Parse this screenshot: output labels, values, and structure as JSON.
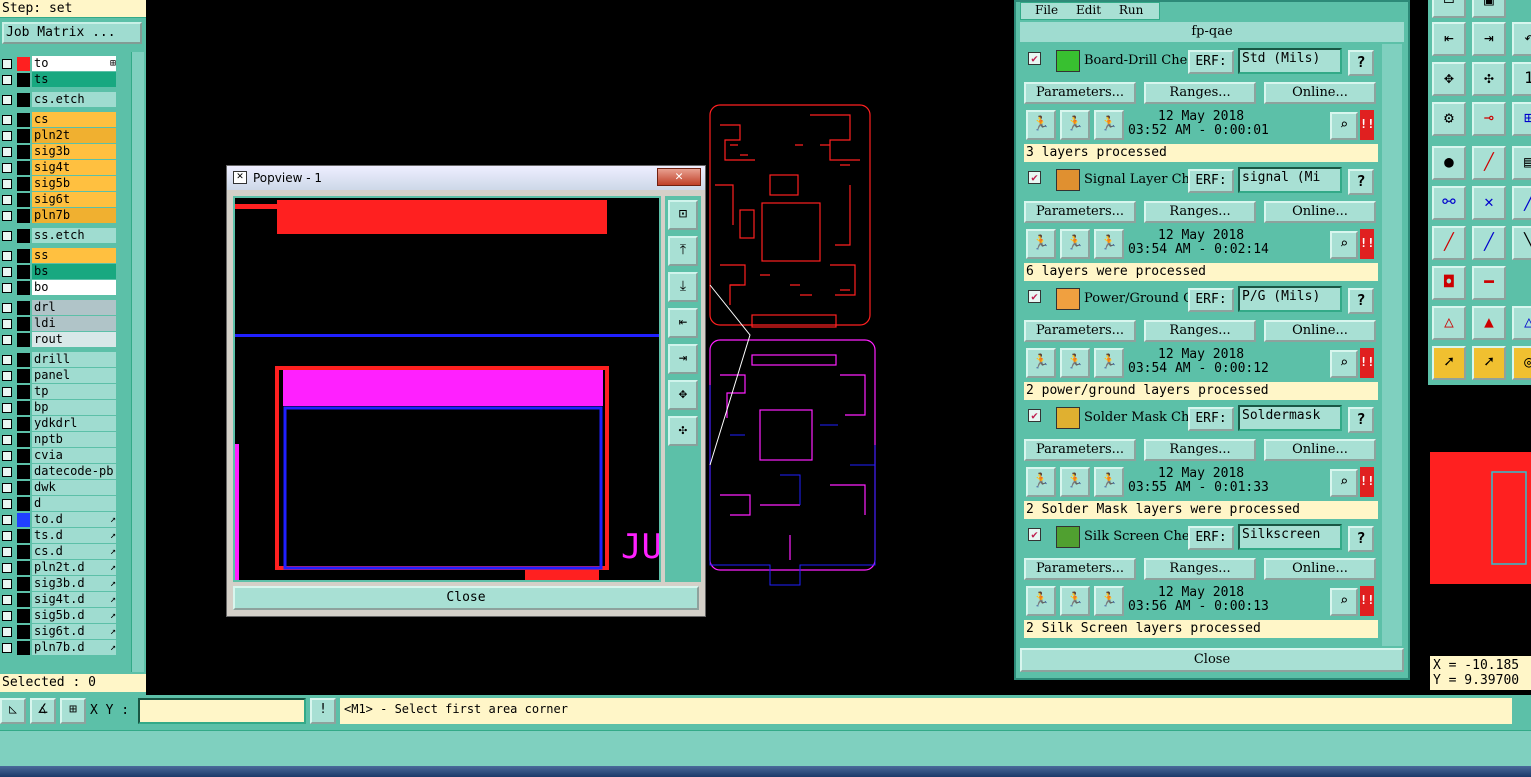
{
  "step_label": "Step: set",
  "job_matrix_label": "Job Matrix ...",
  "layers": [
    {
      "name": "to",
      "color": "#ffffff",
      "sel": "#ff2020",
      "arrow": "⊞",
      "check": "■"
    },
    {
      "name": "ts",
      "color": "#18a880",
      "sel": "#000000",
      "arrow": "",
      "check": ""
    },
    {
      "name": "cs.etch",
      "color": "#9fdcd0",
      "sel": "#000000",
      "arrow": "",
      "check": ""
    },
    {
      "name": "cs",
      "color": "#ffc040",
      "sel": "#000000",
      "arrow": "",
      "check": ""
    },
    {
      "name": "pln2t",
      "color": "#f0b030",
      "sel": "#000000",
      "arrow": "",
      "check": ""
    },
    {
      "name": "sig3b",
      "color": "#ffc040",
      "sel": "#000000",
      "arrow": "",
      "check": ""
    },
    {
      "name": "sig4t",
      "color": "#ffc040",
      "sel": "#000000",
      "arrow": "",
      "check": ""
    },
    {
      "name": "sig5b",
      "color": "#ffc040",
      "sel": "#000000",
      "arrow": "",
      "check": ""
    },
    {
      "name": "sig6t",
      "color": "#ffc040",
      "sel": "#000000",
      "arrow": "",
      "check": ""
    },
    {
      "name": "pln7b",
      "color": "#f0b030",
      "sel": "#000000",
      "arrow": "",
      "check": ""
    },
    {
      "name": "ss.etch",
      "color": "#9fdcd0",
      "sel": "#000000",
      "arrow": "",
      "check": ""
    },
    {
      "name": "ss",
      "color": "#ffc040",
      "sel": "#000000",
      "arrow": "",
      "check": ""
    },
    {
      "name": "bs",
      "color": "#18a880",
      "sel": "#000000",
      "arrow": "",
      "check": ""
    },
    {
      "name": "bo",
      "color": "#ffffff",
      "sel": "#000000",
      "arrow": "",
      "check": ""
    },
    {
      "name": "drl",
      "color": "#b0c4c8",
      "sel": "#000000",
      "arrow": "",
      "check": ""
    },
    {
      "name": "ldi",
      "color": "#b0c4c8",
      "sel": "#000000",
      "arrow": "",
      "check": ""
    },
    {
      "name": "rout",
      "color": "#d8e8e8",
      "sel": "#000000",
      "arrow": "",
      "check": ""
    },
    {
      "name": "drill",
      "color": "#9fdcd0",
      "sel": "#000000",
      "arrow": "",
      "check": ""
    },
    {
      "name": "panel",
      "color": "#9fdcd0",
      "sel": "#000000",
      "arrow": "",
      "check": ""
    },
    {
      "name": "tp",
      "color": "#9fdcd0",
      "sel": "#000000",
      "arrow": "",
      "check": ""
    },
    {
      "name": "bp",
      "color": "#9fdcd0",
      "sel": "#000000",
      "arrow": "",
      "check": ""
    },
    {
      "name": "ydkdrl",
      "color": "#9fdcd0",
      "sel": "#000000",
      "arrow": "",
      "check": ""
    },
    {
      "name": "nptb",
      "color": "#9fdcd0",
      "sel": "#000000",
      "arrow": "",
      "check": ""
    },
    {
      "name": "cvia",
      "color": "#9fdcd0",
      "sel": "#000000",
      "arrow": "",
      "check": ""
    },
    {
      "name": "datecode-pb",
      "color": "#9fdcd0",
      "sel": "#000000",
      "arrow": "",
      "check": ""
    },
    {
      "name": "dwk",
      "color": "#9fdcd0",
      "sel": "#000000",
      "arrow": "",
      "check": ""
    },
    {
      "name": "d",
      "color": "#9fdcd0",
      "sel": "#000000",
      "arrow": "",
      "check": ""
    },
    {
      "name": "to.d",
      "color": "#9fdcd0",
      "sel": "#2040ff",
      "arrow": "↗",
      "check": ""
    },
    {
      "name": "ts.d",
      "color": "#9fdcd0",
      "sel": "#000000",
      "arrow": "↗",
      "check": ""
    },
    {
      "name": "cs.d",
      "color": "#9fdcd0",
      "sel": "#000000",
      "arrow": "↗",
      "check": ""
    },
    {
      "name": "pln2t.d",
      "color": "#9fdcd0",
      "sel": "#000000",
      "arrow": "↗",
      "check": ""
    },
    {
      "name": "sig3b.d",
      "color": "#9fdcd0",
      "sel": "#000000",
      "arrow": "↗",
      "check": ""
    },
    {
      "name": "sig4t.d",
      "color": "#9fdcd0",
      "sel": "#000000",
      "arrow": "↗",
      "check": ""
    },
    {
      "name": "sig5b.d",
      "color": "#9fdcd0",
      "sel": "#000000",
      "arrow": "↗",
      "check": ""
    },
    {
      "name": "sig6t.d",
      "color": "#9fdcd0",
      "sel": "#000000",
      "arrow": "↗",
      "check": ""
    },
    {
      "name": "pln7b.d",
      "color": "#9fdcd0",
      "sel": "#000000",
      "arrow": "↗",
      "check": ""
    }
  ],
  "selected_label": "Selected : 0",
  "popview": {
    "title": "Popview - 1",
    "close_x": "✕",
    "close_label": "Close",
    "overlay_text": "JU"
  },
  "checklist": {
    "menu": [
      "File",
      "Edit",
      "Run"
    ],
    "title": "fp-qae",
    "param_label": "Parameters...",
    "ranges_label": "Ranges...",
    "online_label": "Online...",
    "erf_label": "ERF:",
    "q_label": "?",
    "bang_label": "!!",
    "check_mark": "✔",
    "close_label": "Close",
    "items": [
      {
        "name": "Board-Drill Che",
        "erf": "Std (Mils)",
        "date": "12 May 2018",
        "time": "03:52 AM - 0:00:01",
        "status": "3 layers processed",
        "icon_color": "#38c030"
      },
      {
        "name": "Signal Layer Ch",
        "erf": "signal (Mi",
        "date": "12 May 2018",
        "time": "03:54 AM - 0:02:14",
        "status": "6 layers were processed",
        "icon_color": "#e09030"
      },
      {
        "name": "Power/Ground C:",
        "erf": "P/G (Mils)",
        "date": "12 May 2018",
        "time": "03:54 AM - 0:00:12",
        "status": "2 power/ground layers processed",
        "icon_color": "#f0a040"
      },
      {
        "name": "Solder Mask Ch",
        "erf": "Soldermask",
        "date": "12 May 2018",
        "time": "03:55 AM - 0:01:33",
        "status": "2 Solder Mask layers were processed",
        "icon_color": "#e0b030"
      },
      {
        "name": "Silk Screen Che",
        "erf": "Silkscreen",
        "date": "12 May 2018",
        "time": "03:56 AM - 0:00:13",
        "status": "2 Silk Screen layers processed",
        "icon_color": "#50a030"
      }
    ]
  },
  "coords": {
    "x": "X = -10.185",
    "y": "Y = 9.39700"
  },
  "bottom": {
    "xy_label": "X Y :",
    "xy_value": "",
    "bang": "!",
    "message": "<M1> - Select first area corner"
  },
  "colors": {
    "panel": "#5cc0a8",
    "field": "#fff6c8",
    "layer_top": "#ff2020",
    "layer_bottom": "#2020ff",
    "magenta": "#ff20ff"
  }
}
